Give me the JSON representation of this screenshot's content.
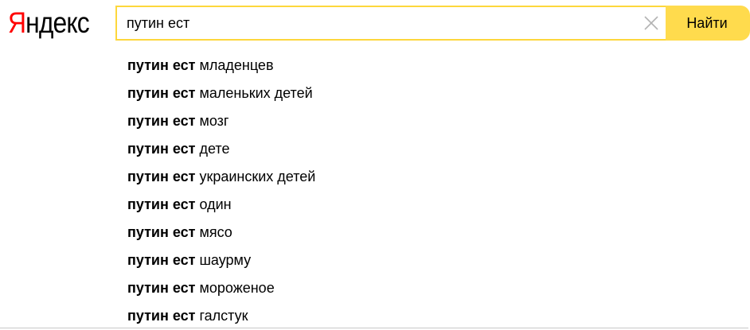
{
  "logo": {
    "first_letter": "Я",
    "rest": "ндекс"
  },
  "search": {
    "query": "путин ест",
    "clear_icon": "close-icon",
    "button_label": "Найти",
    "accent_color": "#ffdb4d",
    "border_color": "#fdd73c"
  },
  "suggestions": [
    {
      "prefix": "путин ест",
      "completion": "младенцев"
    },
    {
      "prefix": "путин ест",
      "completion": "маленьких детей"
    },
    {
      "prefix": "путин ест",
      "completion": "мозг"
    },
    {
      "prefix": "путин ест",
      "completion": "дете"
    },
    {
      "prefix": "путин ест",
      "completion": "украинских детей"
    },
    {
      "prefix": "путин ест",
      "completion": "один"
    },
    {
      "prefix": "путин ест",
      "completion": "мясо"
    },
    {
      "prefix": "путин ест",
      "completion": "шаурму"
    },
    {
      "prefix": "путин ест",
      "completion": "мороженое"
    },
    {
      "prefix": "путин ест",
      "completion": "галстук"
    }
  ]
}
